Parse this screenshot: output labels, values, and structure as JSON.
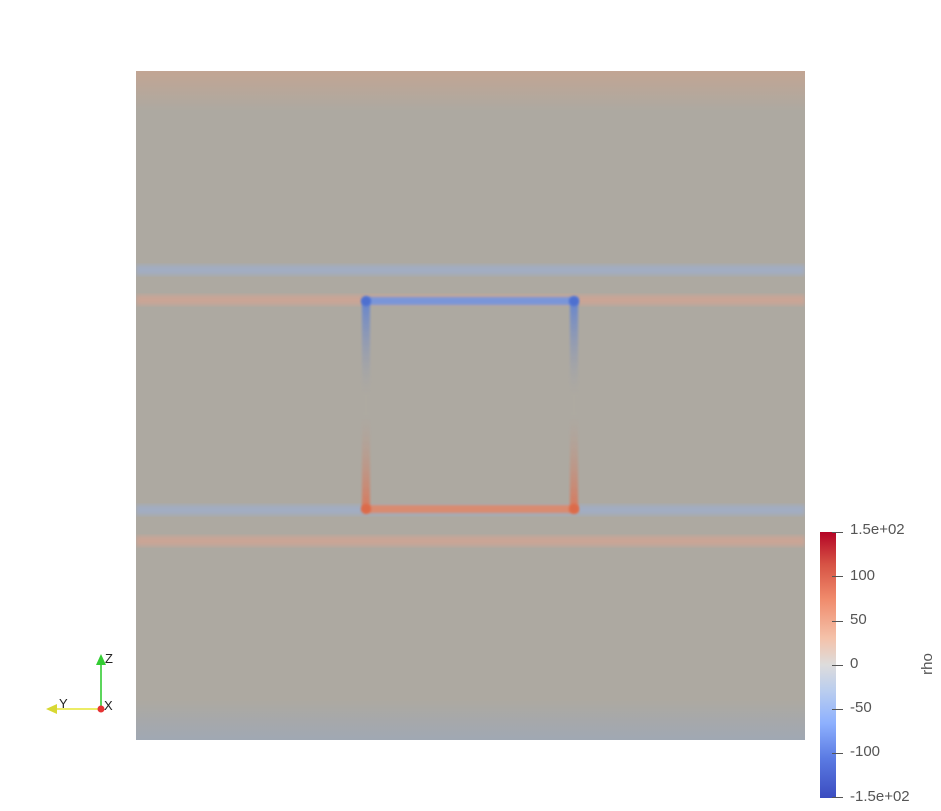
{
  "viewer": {
    "scalar_name": "rho",
    "colorbar": {
      "range": [
        -150,
        150
      ],
      "labels": [
        {
          "value": 150,
          "text": "1.5e+02"
        },
        {
          "value": 100,
          "text": "100"
        },
        {
          "value": 50,
          "text": "50"
        },
        {
          "value": 0,
          "text": "0"
        },
        {
          "value": -50,
          "text": "-50"
        },
        {
          "value": -100,
          "text": "-100"
        },
        {
          "value": -150,
          "text": "-1.5e+02"
        }
      ],
      "colormap": "Cool to Warm",
      "colors": {
        "max": "#b40426",
        "mid": "#dddddd",
        "min": "#3b4cc0"
      }
    },
    "orientation_axes": {
      "z_label": "Z",
      "y_label": "Y",
      "x_label": "X",
      "colors": {
        "z": "#33cc33",
        "y": "#e6e633",
        "x": "#e63333"
      }
    },
    "field_colors": {
      "background": "#ada9a1",
      "positive_band": "#d4a595",
      "negative_band": "#a1adc1",
      "positive_edge": "#e07050",
      "negative_edge": "#5a7fd6"
    }
  }
}
